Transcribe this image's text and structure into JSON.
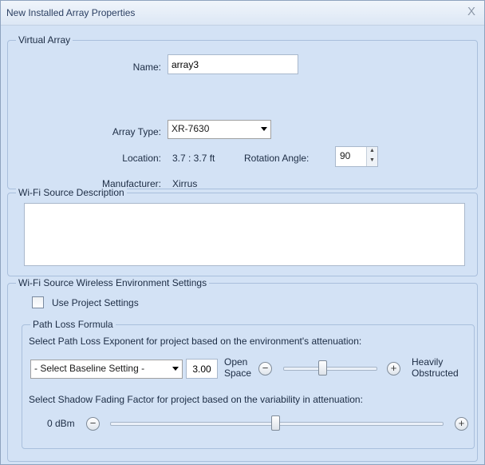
{
  "window": {
    "title": "New Installed Array Properties",
    "close_symbol": "X"
  },
  "virtual_array": {
    "legend": "Virtual Array",
    "name_label": "Name:",
    "name_value": "array3",
    "type_label": "Array Type:",
    "type_value": "XR-7630",
    "location_label": "Location:",
    "location_value": "3.7 : 3.7 ft",
    "rotation_label": "Rotation Angle:",
    "rotation_value": "90",
    "manufacturer_label": "Manufacturer:",
    "manufacturer_value": "Xirrus"
  },
  "description": {
    "legend": "Wi-Fi Source Description",
    "value": ""
  },
  "environment": {
    "legend": "Wi-Fi Source Wireless Environment Settings",
    "use_project_label": "Use Project Settings",
    "use_project_checked": false,
    "path_loss": {
      "legend": "Path Loss Formula",
      "exponent_prompt": "Select Path Loss Exponent for project based on the environment's attenuation:",
      "baseline_value": "- Select Baseline Setting -",
      "exponent_value": "3.00",
      "open_label_1": "Open",
      "open_label_2": "Space",
      "obstructed_label_1": "Heavily",
      "obstructed_label_2": "Obstructed",
      "minus_symbol": "−",
      "plus_symbol": "+",
      "shadow_prompt": "Select Shadow Fading Factor for project based on the variability in attenuation:",
      "shadow_value": "0 dBm"
    }
  },
  "icons": {
    "spin_up": "▲",
    "spin_down": "▼"
  }
}
